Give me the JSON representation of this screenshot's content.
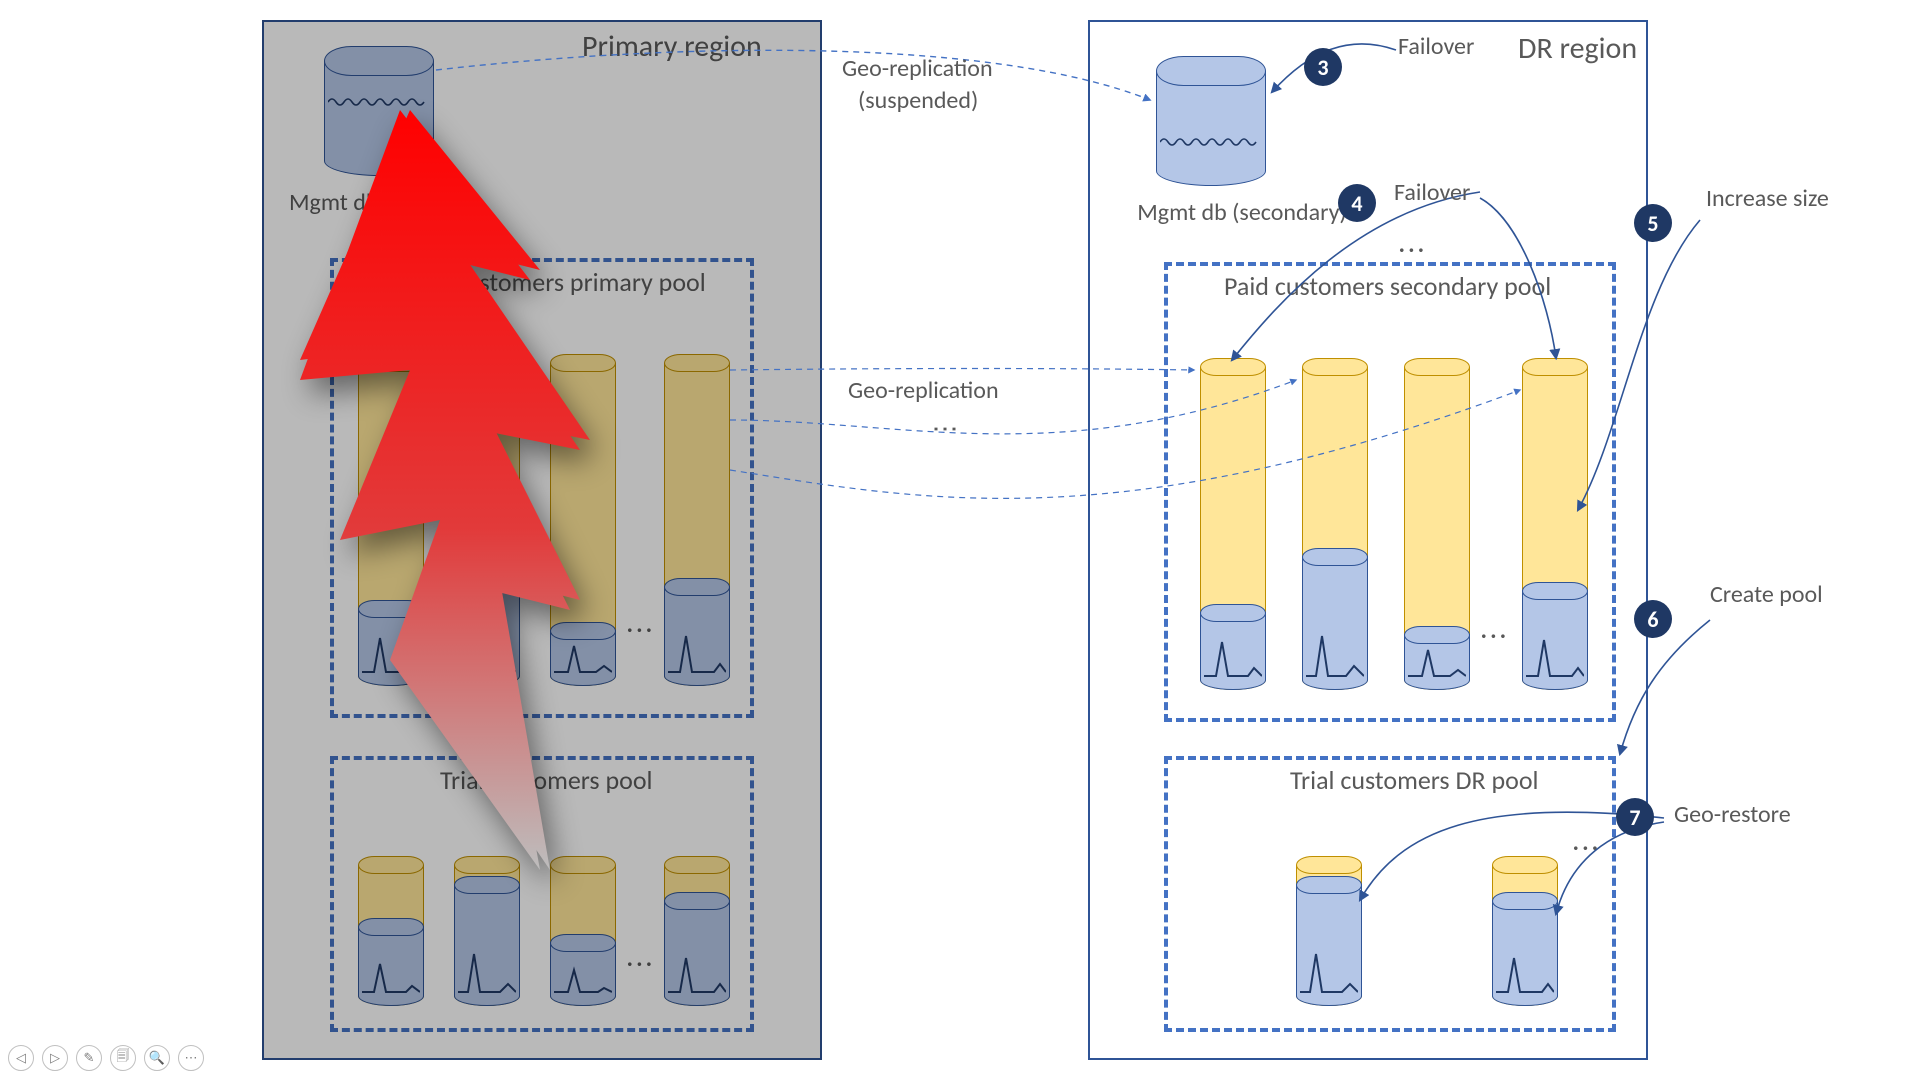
{
  "primary": {
    "title": "Primary region",
    "db_label": "Mgmt db (primary)",
    "paid_pool_title": "Paid customers primary pool",
    "trial_pool_title": "Trial customers pool"
  },
  "dr": {
    "title": "DR region",
    "db_label": "Mgmt db (secondary)",
    "paid_pool_title": "Paid customers secondary pool",
    "trial_pool_title": "Trial customers DR pool"
  },
  "connectors": {
    "geo_rep_suspended_1": "Geo-replication",
    "geo_rep_suspended_2": "(suspended)",
    "geo_rep": "Geo-replication"
  },
  "annotations": {
    "failover3": "Failover",
    "failover4": "Failover",
    "increase_size": "Increase size",
    "create_pool": "Create pool",
    "geo_restore": "Geo-restore"
  },
  "badges": {
    "b3": "3",
    "b4": "4",
    "b5": "5",
    "b6": "6",
    "b7": "7"
  },
  "toolbar": {
    "prev": "◁",
    "next": "▷",
    "pen": "✎",
    "copy": "🗐",
    "zoom": "🔍",
    "menu": "⋯"
  },
  "ellipsis": "..."
}
